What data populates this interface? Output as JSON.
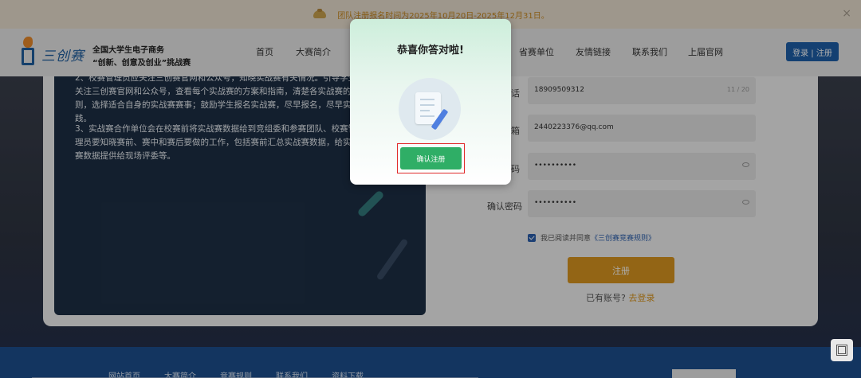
{
  "notice": {
    "text": "团队注册报名时间为2025年10月20日-2025年12月31日。",
    "close": "×"
  },
  "header": {
    "logo_name": "三创赛",
    "logo_line1": "全国大学生电子商务",
    "logo_line2": "“创新、创意及创业”挑战赛",
    "nav": [
      "首页",
      "大赛简介",
      "省赛单位",
      "友情链接",
      "联系我们",
      "上届官网"
    ],
    "login_label": "登录 | 注册"
  },
  "left_panel": {
    "paragraph1": "2、校赛管理员应关注三创赛官网和公众号，知晓实战赛有关情况。引导学生关注三创赛官网和公众号，查看每个实战赛的方案和指南，清楚各实战赛的规则，选择适合自身的实战赛赛事；鼓励学生报名实战赛，尽早报名，尽早实践。",
    "paragraph2": "3、实战赛合作单位会在校赛前将实战赛数据给到竞组委和参赛团队、校赛管理员要知晓赛前、赛中和赛后要做的工作，包括赛前汇总实战赛数据，给实战赛数据提供给现场评委等。"
  },
  "form": {
    "phone_label": "话",
    "phone_value": "18909509312",
    "phone_count": "11 / 20",
    "email_label": "箱",
    "email_value": "2440223376@qq.com",
    "password_label": "码",
    "password_value": "••••••••••",
    "confirm_label": "确认密码",
    "confirm_value": "••••••••••",
    "agree_text": "我已阅读并同意",
    "agree_link": "《三创赛竞赛规则》",
    "register_label": "注册",
    "has_account": "已有账号?",
    "go_login": "去登录"
  },
  "footer": {
    "links": [
      "网站首页",
      "大赛简介",
      "竞赛规则",
      "联系我们",
      "资料下载"
    ]
  },
  "modal": {
    "title": "恭喜你答对啦!",
    "confirm_label": "确认注册"
  },
  "colors": {
    "accent_blue": "#1e5fa8",
    "accent_orange": "#d9951f",
    "confirm_green": "#2fae66",
    "highlight_red": "#e12a2a"
  }
}
